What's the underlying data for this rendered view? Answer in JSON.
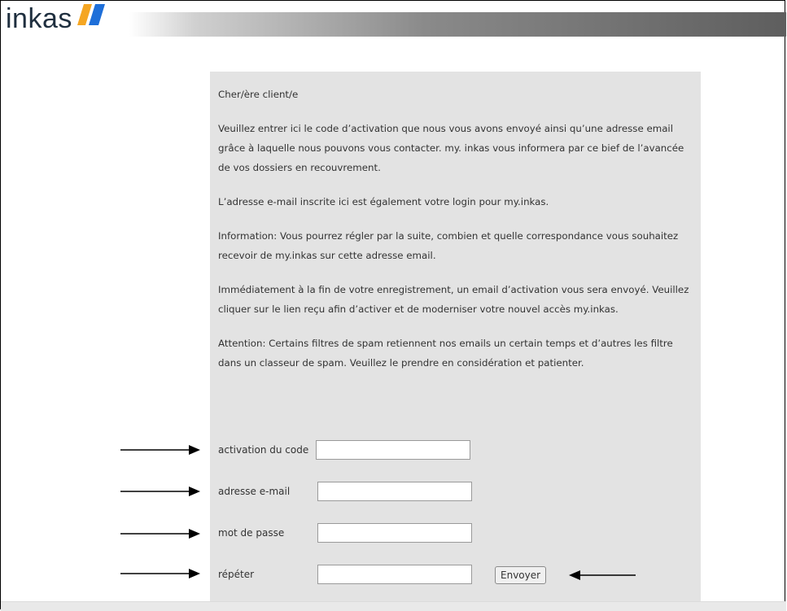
{
  "brand": {
    "logo_text": "inkas",
    "logo_colors": {
      "primary": "#f5a623",
      "secondary": "#1e6fd9"
    }
  },
  "content": {
    "paragraphs": [
      "Cher/ère client/e",
      "Veuillez entrer ici le code d’activation que nous vous avons envoyé ainsi qu’une adresse email grâce à laquelle nous pouvons vous contacter. my. inkas vous informera par ce bief de l’avancée de vos dossiers en recouvrement.",
      "L’adresse e-mail inscrite ici est également votre login pour my.inkas.",
      "Information: Vous pourrez régler par la suite, combien et quelle correspondance vous souhaitez recevoir de my.inkas sur cette adresse email.",
      "Immédiatement à la fin de votre enregistrement, un email d’activation vous sera envoyé. Veuillez cliquer sur le lien reçu afin d’activer et de moderniser votre nouvel accès my.inkas.",
      "Attention: Certains filtres de spam retiennent nos emails un certain temps et d’autres les filtre dans un classeur de spam. Veuillez le prendre en considération et patienter."
    ]
  },
  "form": {
    "activation_label": "activation du code",
    "activation_value": "",
    "email_label": "adresse e-mail",
    "email_value": "",
    "password_label": "mot de passe",
    "password_value": "",
    "repeat_label": "répéter",
    "repeat_value": "",
    "submit_label": "Envoyer"
  },
  "colors": {
    "panel_bg": "#e3e3e3",
    "text": "#333333"
  }
}
